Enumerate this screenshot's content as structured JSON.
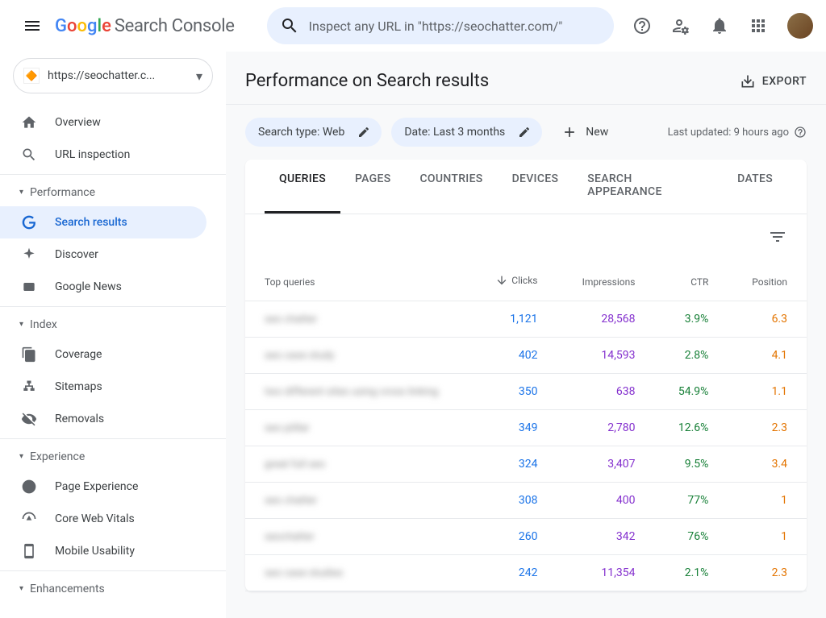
{
  "header": {
    "product_name": "Search Console",
    "search_placeholder": "Inspect any URL in \"https://seochatter.com/\""
  },
  "property": {
    "domain": "https://seochatter.c..."
  },
  "sidebar": {
    "items": [
      {
        "label": "Overview"
      },
      {
        "label": "URL inspection"
      }
    ],
    "sections": [
      {
        "title": "Performance",
        "items": [
          {
            "label": "Search results"
          },
          {
            "label": "Discover"
          },
          {
            "label": "Google News"
          }
        ]
      },
      {
        "title": "Index",
        "items": [
          {
            "label": "Coverage"
          },
          {
            "label": "Sitemaps"
          },
          {
            "label": "Removals"
          }
        ]
      },
      {
        "title": "Experience",
        "items": [
          {
            "label": "Page Experience"
          },
          {
            "label": "Core Web Vitals"
          },
          {
            "label": "Mobile Usability"
          }
        ]
      },
      {
        "title": "Enhancements",
        "items": []
      }
    ]
  },
  "page": {
    "title": "Performance on Search results",
    "export": "EXPORT"
  },
  "filters": {
    "search_type": "Search type: Web",
    "date": "Date: Last 3 months",
    "new": "New",
    "last_updated": "Last updated: 9 hours ago"
  },
  "tabs": [
    "QUERIES",
    "PAGES",
    "COUNTRIES",
    "DEVICES",
    "SEARCH APPEARANCE",
    "DATES"
  ],
  "table": {
    "headers": {
      "query": "Top queries",
      "clicks": "Clicks",
      "impressions": "Impressions",
      "ctr": "CTR",
      "position": "Position"
    },
    "rows": [
      {
        "query": "seo chatter",
        "clicks": "1,121",
        "impressions": "28,568",
        "ctr": "3.9%",
        "position": "6.3"
      },
      {
        "query": "seo case study",
        "clicks": "402",
        "impressions": "14,593",
        "ctr": "2.8%",
        "position": "4.1"
      },
      {
        "query": "two different sites using cross linking",
        "clicks": "350",
        "impressions": "638",
        "ctr": "54.9%",
        "position": "1.1"
      },
      {
        "query": "seo piillar",
        "clicks": "349",
        "impressions": "2,780",
        "ctr": "12.6%",
        "position": "2.3"
      },
      {
        "query": "great full seo",
        "clicks": "324",
        "impressions": "3,407",
        "ctr": "9.5%",
        "position": "3.4"
      },
      {
        "query": "seo chatter",
        "clicks": "308",
        "impressions": "400",
        "ctr": "77%",
        "position": "1"
      },
      {
        "query": "seochatter",
        "clicks": "260",
        "impressions": "342",
        "ctr": "76%",
        "position": "1"
      },
      {
        "query": "seo case studies",
        "clicks": "242",
        "impressions": "11,354",
        "ctr": "2.1%",
        "position": "2.3"
      }
    ]
  }
}
